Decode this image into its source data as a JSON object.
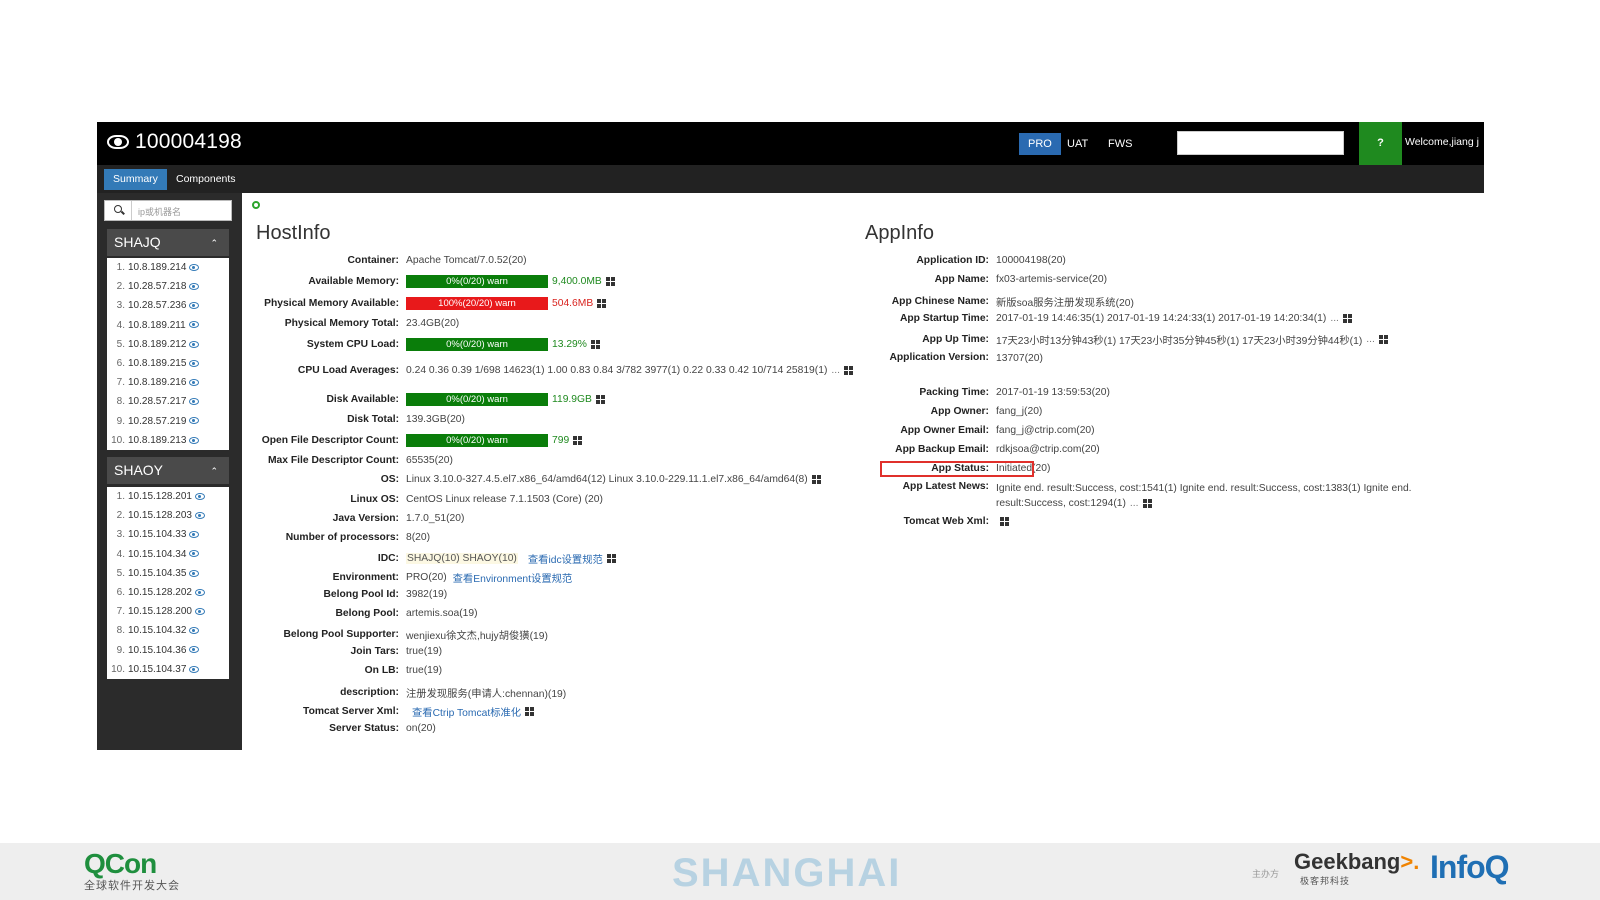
{
  "app": {
    "title": "100004198",
    "env_buttons": [
      "PRO",
      "UAT",
      "FWS"
    ],
    "help_label": "?",
    "welcome": "Welcome,jiang j"
  },
  "tabs": [
    "Summary",
    "Components"
  ],
  "sidebar": {
    "search_placeholder": "ip或机器名",
    "groups": [
      {
        "name": "SHAJQ",
        "items": [
          {
            "num": "1.",
            "ip": "10.8.189.214"
          },
          {
            "num": "2.",
            "ip": "10.28.57.218"
          },
          {
            "num": "3.",
            "ip": "10.28.57.236"
          },
          {
            "num": "4.",
            "ip": "10.8.189.211"
          },
          {
            "num": "5.",
            "ip": "10.8.189.212"
          },
          {
            "num": "6.",
            "ip": "10.8.189.215"
          },
          {
            "num": "7.",
            "ip": "10.8.189.216"
          },
          {
            "num": "8.",
            "ip": "10.28.57.217"
          },
          {
            "num": "9.",
            "ip": "10.28.57.219"
          },
          {
            "num": "10.",
            "ip": "10.8.189.213"
          }
        ]
      },
      {
        "name": "SHAOY",
        "items": [
          {
            "num": "1.",
            "ip": "10.15.128.201"
          },
          {
            "num": "2.",
            "ip": "10.15.128.203"
          },
          {
            "num": "3.",
            "ip": "10.15.104.33"
          },
          {
            "num": "4.",
            "ip": "10.15.104.34"
          },
          {
            "num": "5.",
            "ip": "10.15.104.35"
          },
          {
            "num": "6.",
            "ip": "10.15.128.202"
          },
          {
            "num": "7.",
            "ip": "10.15.128.200"
          },
          {
            "num": "8.",
            "ip": "10.15.104.32"
          },
          {
            "num": "9.",
            "ip": "10.15.104.36"
          },
          {
            "num": "10.",
            "ip": "10.15.104.37"
          }
        ]
      }
    ]
  },
  "hostinfo": {
    "title": "HostInfo",
    "rows": [
      {
        "label": "Container:",
        "value": "Apache Tomcat/7.0.52(20)"
      },
      {
        "label": "Available Memory:",
        "bar": "0%(0/20) warn",
        "bar_state": "ok",
        "after": "9,400.0MB",
        "grid": true
      },
      {
        "label": "Physical Memory Available:",
        "bar": "100%(20/20) warn",
        "bar_state": "bad",
        "after": "504.6MB",
        "grid": true
      },
      {
        "label": "Physical Memory Total:",
        "value": "23.4GB(20)"
      },
      {
        "label": "System CPU Load:",
        "bar": "0%(0/20) warn",
        "bar_state": "ok",
        "after": "13.29%",
        "grid": true
      },
      {
        "label": "CPU Load Averages:",
        "value": "0.24 0.36 0.39 1/698 14623(1)  1.00 0.83 0.84 3/782 3977(1)  0.22 0.33 0.42 10/714 25819(1)",
        "dots": "...",
        "grid": true
      },
      {
        "label": "Disk Available:",
        "bar": "0%(0/20) warn",
        "bar_state": "ok",
        "after": "119.9GB",
        "grid": true
      },
      {
        "label": "Disk Total:",
        "value": "139.3GB(20)"
      },
      {
        "label": "Open File Descriptor Count:",
        "bar": "0%(0/20) warn",
        "bar_state": "ok",
        "after": "799",
        "grid": true
      },
      {
        "label": "Max File Descriptor Count:",
        "value": "65535(20)"
      },
      {
        "label": "OS:",
        "value": "Linux 3.10.0-327.4.5.el7.x86_64/amd64(12)  Linux 3.10.0-229.11.1.el7.x86_64/amd64(8)",
        "grid": true
      },
      {
        "label": "Linux OS:",
        "value": "CentOS Linux release 7.1.1503 (Core) (20)"
      },
      {
        "label": "Java Version:",
        "value": "1.7.0_51(20)"
      },
      {
        "label": "Number of processors:",
        "value": "8(20)"
      },
      {
        "label": "IDC:",
        "value": "SHAJQ(10)  SHAOY(10)",
        "link": "查看idc设置规范",
        "grid": true
      },
      {
        "label": "Environment:",
        "value": "PRO(20)",
        "link": "查看Environment设置规范"
      },
      {
        "label": "Belong Pool Id:",
        "value": "3982(19)"
      },
      {
        "label": "Belong Pool:",
        "value": "artemis.soa(19)"
      },
      {
        "label": "Belong Pool Supporter:",
        "value": "wenjiexu徐文杰,hujy胡俊獚(19)"
      },
      {
        "label": "Join Tars:",
        "value": "true(19)"
      },
      {
        "label": "On LB:",
        "value": "true(19)"
      },
      {
        "label": "description:",
        "value": "注册发现服务(申请人:chennan)(19)"
      },
      {
        "label": "Tomcat Server Xml:",
        "value": "",
        "link": "查看Ctrip Tomcat标准化",
        "grid": true
      },
      {
        "label": "Server Status:",
        "value": "on(20)"
      }
    ]
  },
  "appinfo": {
    "title": "AppInfo",
    "rows": [
      {
        "label": "Application ID:",
        "value": "100004198(20)"
      },
      {
        "label": "App Name:",
        "value": "fx03-artemis-service(20)"
      },
      {
        "label": "App Chinese Name:",
        "value": "新版soa服务注册发现系统(20)"
      },
      {
        "label": "App Startup Time:",
        "value": "2017-01-19 14:46:35(1)  2017-01-19 14:24:33(1)  2017-01-19 14:20:34(1)",
        "dots": "...",
        "grid": true
      },
      {
        "label": "App Up Time:",
        "value": "17天23小时13分钟43秒(1)  17天23小时35分钟45秒(1)  17天23小时39分钟44秒(1)",
        "dots": "...",
        "grid": true
      },
      {
        "label": "Application Version:",
        "value": "13707(20)"
      },
      {
        "label": "Packing Time:",
        "value": "2017-01-19 13:59:53(20)"
      },
      {
        "label": "App Owner:",
        "value": "fang_j(20)"
      },
      {
        "label": "App Owner Email:",
        "value": "fang_j@ctrip.com(20)"
      },
      {
        "label": "App Backup Email:",
        "value": "rdkjsoa@ctrip.com(20)"
      },
      {
        "label": "App Status:",
        "value": "Initiated(20)"
      },
      {
        "label": "App Latest News:",
        "value": "Ignite end. result:Success, cost:1541(1)  Ignite end. result:Success, cost:1383(1)  Ignite end.",
        "value2": "result:Success, cost:1294(1)",
        "dots": "...",
        "grid": true
      },
      {
        "label": "Tomcat Web Xml:",
        "value": "",
        "grid": true
      }
    ]
  },
  "footer": {
    "qcon": "QCon",
    "qcon_sub": "全球软件开发大会",
    "city": "SHANGHAI",
    "sponsor": "主办方",
    "geekbang": "Geekbang",
    "geekbang_arrow": ">.",
    "geekbang_sub": "极客邦科技",
    "infoq": "InfoQ"
  }
}
